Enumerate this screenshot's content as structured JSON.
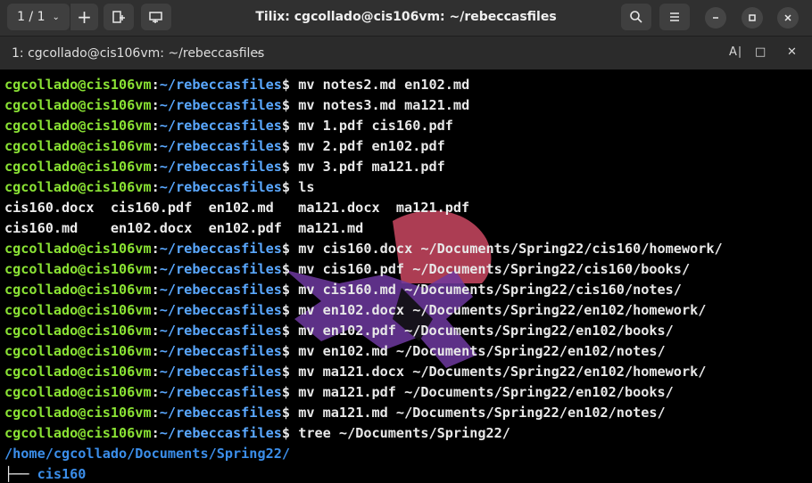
{
  "titlebar": {
    "session_label": "1 / 1",
    "title": "Tilix: cgcollado@cis106vm: ~/rebeccasfiles"
  },
  "tab": {
    "title": "1: cgcollado@cis106vm: ~/rebeccasfiles"
  },
  "icons": {
    "session_chevron": "chevron-down-icon",
    "add": "plus-icon",
    "split_h": "split-horizontal-icon",
    "split_v": "split-vertical-icon",
    "search": "search-icon",
    "menu": "hamburger-menu-icon",
    "minimize": "minimize-icon",
    "maximize": "maximize-icon",
    "close": "close-icon",
    "readonly": "read-only-icon"
  },
  "prompt": {
    "user": "cgcollado@cis106vm",
    "sep": ":",
    "path": "~/rebeccasfiles",
    "sym": "$ "
  },
  "terminal": {
    "commands": [
      "mv notes2.md en102.md",
      "mv notes3.md ma121.md",
      "mv 1.pdf cis160.pdf",
      "mv 2.pdf en102.pdf",
      "mv 3.pdf ma121.pdf",
      "ls"
    ],
    "ls_output": [
      "cis160.docx  cis160.pdf  en102.md   ma121.docx  ma121.pdf",
      "cis160.md    en102.docx  en102.pdf  ma121.md"
    ],
    "commands2": [
      "mv cis160.docx ~/Documents/Spring22/cis160/homework/",
      "mv cis160.pdf ~/Documents/Spring22/cis160/books/",
      "mv cis160.md ~/Documents/Spring22/cis160/notes/",
      "mv en102.docx ~/Documents/Spring22/en102/homework/",
      "mv en102.pdf ~/Documents/Spring22/en102/books/",
      "mv en102.md ~/Documents/Spring22/en102/notes/",
      "mv ma121.docx ~/Documents/Spring22/en102/homework/",
      "mv ma121.pdf ~/Documents/Spring22/en102/books/",
      "mv ma121.md ~/Documents/Spring22/en102/notes/",
      "tree ~/Documents/Spring22/"
    ],
    "tree_root": "/home/cgcollado/Documents/Spring22/",
    "tree_branch": "├── ",
    "tree_item": "cis160"
  },
  "colors": {
    "prompt_user": "#8ae234",
    "prompt_path": "#5aa8ff",
    "directory": "#3b8eea",
    "background": "#000000"
  }
}
